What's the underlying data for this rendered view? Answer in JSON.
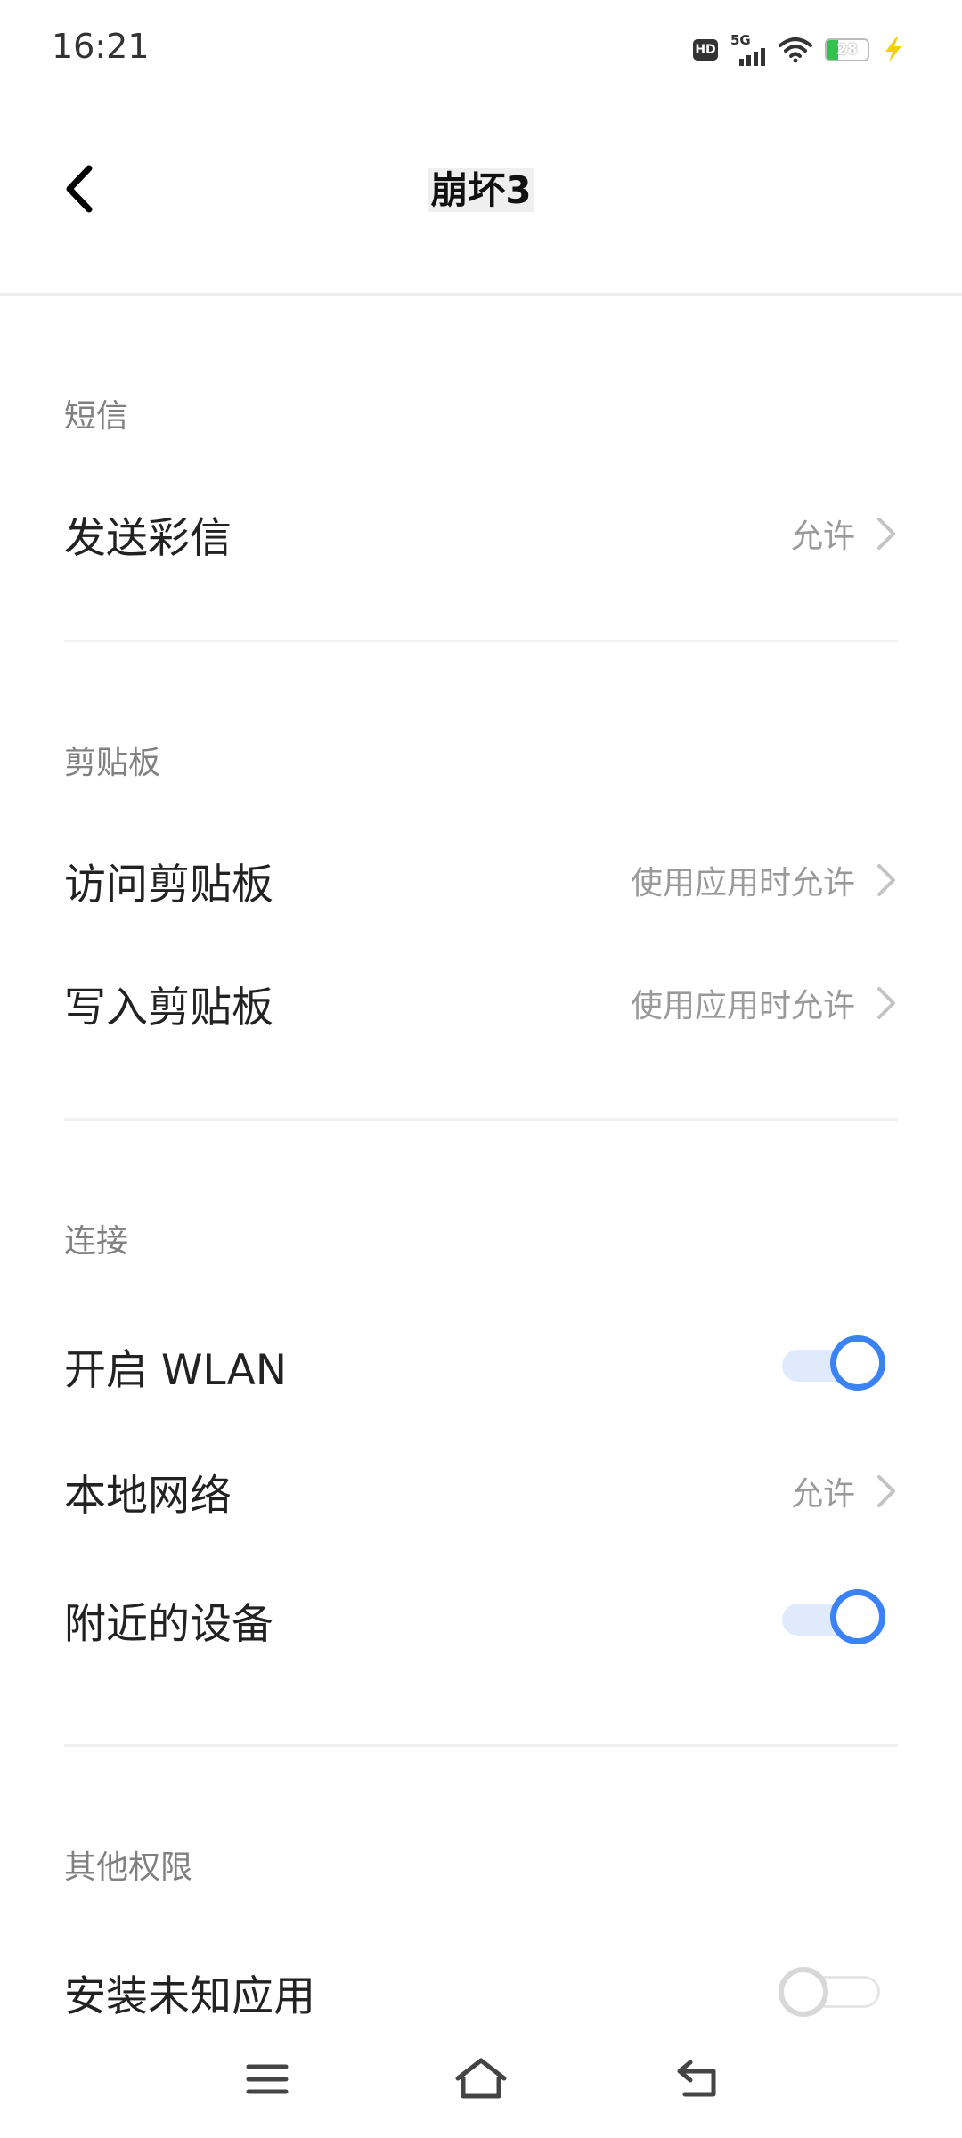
{
  "status_bar": {
    "time": "16:21",
    "network_label": "5G",
    "hd_label": "HD",
    "battery_level": "28"
  },
  "header": {
    "title": "崩坏3"
  },
  "sections": [
    {
      "title": "短信",
      "rows": [
        {
          "label": "发送彩信",
          "value": "允许",
          "type": "chevron"
        }
      ]
    },
    {
      "title": "剪贴板",
      "rows": [
        {
          "label": "访问剪贴板",
          "value": "使用应用时允许",
          "type": "chevron"
        },
        {
          "label": "写入剪贴板",
          "value": "使用应用时允许",
          "type": "chevron"
        }
      ]
    },
    {
      "title": "连接",
      "rows": [
        {
          "label": "开启 WLAN",
          "type": "toggle",
          "on": true
        },
        {
          "label": "本地网络",
          "value": "允许",
          "type": "chevron"
        },
        {
          "label": "附近的设备",
          "type": "toggle",
          "on": true
        }
      ]
    },
    {
      "title": "其他权限",
      "rows": [
        {
          "label": "安装未知应用",
          "type": "toggle",
          "on": false
        }
      ]
    }
  ],
  "colors": {
    "accent": "#3b82f6",
    "secondary_text": "#9a9a9a",
    "battery": "#33c24d",
    "bolt": "#f5d000"
  },
  "icons": {
    "back": "chevron-left-icon",
    "row_chevron": "chevron-right-icon",
    "nav_menu": "menu-icon",
    "nav_home": "home-icon",
    "nav_back": "back-return-icon"
  }
}
